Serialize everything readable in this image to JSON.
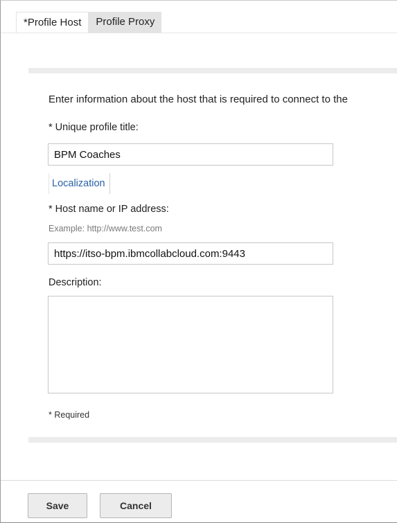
{
  "tabs": [
    {
      "label": "*Profile Host",
      "active": true
    },
    {
      "label": "Profile Proxy",
      "active": false
    }
  ],
  "form": {
    "intro": "Enter information about the host that is required to connect to the",
    "profile_title_label": "* Unique profile title:",
    "profile_title_value": "BPM Coaches",
    "localization_link": "Localization",
    "host_label": "* Host name or IP address:",
    "host_example": "Example: http://www.test.com",
    "host_value": "https://itso-bpm.ibmcollabcloud.com:9443",
    "description_label": "Description:",
    "description_value": "",
    "required_note": "* Required"
  },
  "buttons": {
    "save": "Save",
    "cancel": "Cancel"
  },
  "colors": {
    "link": "#2a61a8",
    "tab_inactive": "#e3e3e3",
    "band": "#ececec"
  }
}
